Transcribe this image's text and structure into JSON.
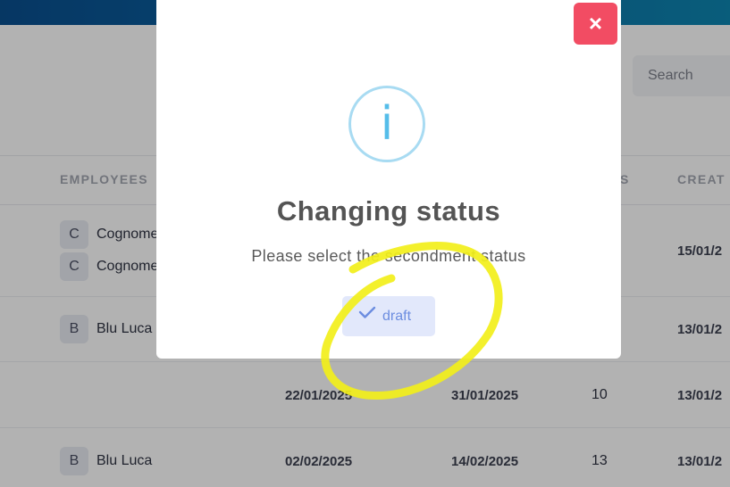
{
  "search": {
    "placeholder": "Search"
  },
  "table": {
    "headers": [
      "EMPLOYEES",
      "S",
      "CREAT"
    ],
    "rows": [
      {
        "chips": [
          "C",
          "C"
        ],
        "names": [
          "Cognome",
          "Cognome"
        ],
        "created": "15/01/2"
      },
      {
        "chips": [
          "B"
        ],
        "names": [
          "Blu Luca"
        ],
        "created": "13/01/2"
      },
      {
        "start": "22/01/2025",
        "end": "31/01/2025",
        "days": "10",
        "created": "13/01/2"
      },
      {
        "chips": [
          "B"
        ],
        "names": [
          "Blu Luca"
        ],
        "start": "02/02/2025",
        "end": "14/02/2025",
        "days": "13",
        "created": "13/01/2"
      }
    ]
  },
  "modal": {
    "close_label": "×",
    "info_glyph": "i",
    "title": "Changing status",
    "subtitle": "Please select the secondment status",
    "option_label": "draft"
  },
  "colors": {
    "close": "#f24c63",
    "info": "#55bde9",
    "option_bg": "#e2e8fb",
    "highlight": "#f2ef1a"
  },
  "icons": {
    "option": "check-icon",
    "info": "info-icon",
    "close": "close-icon"
  }
}
